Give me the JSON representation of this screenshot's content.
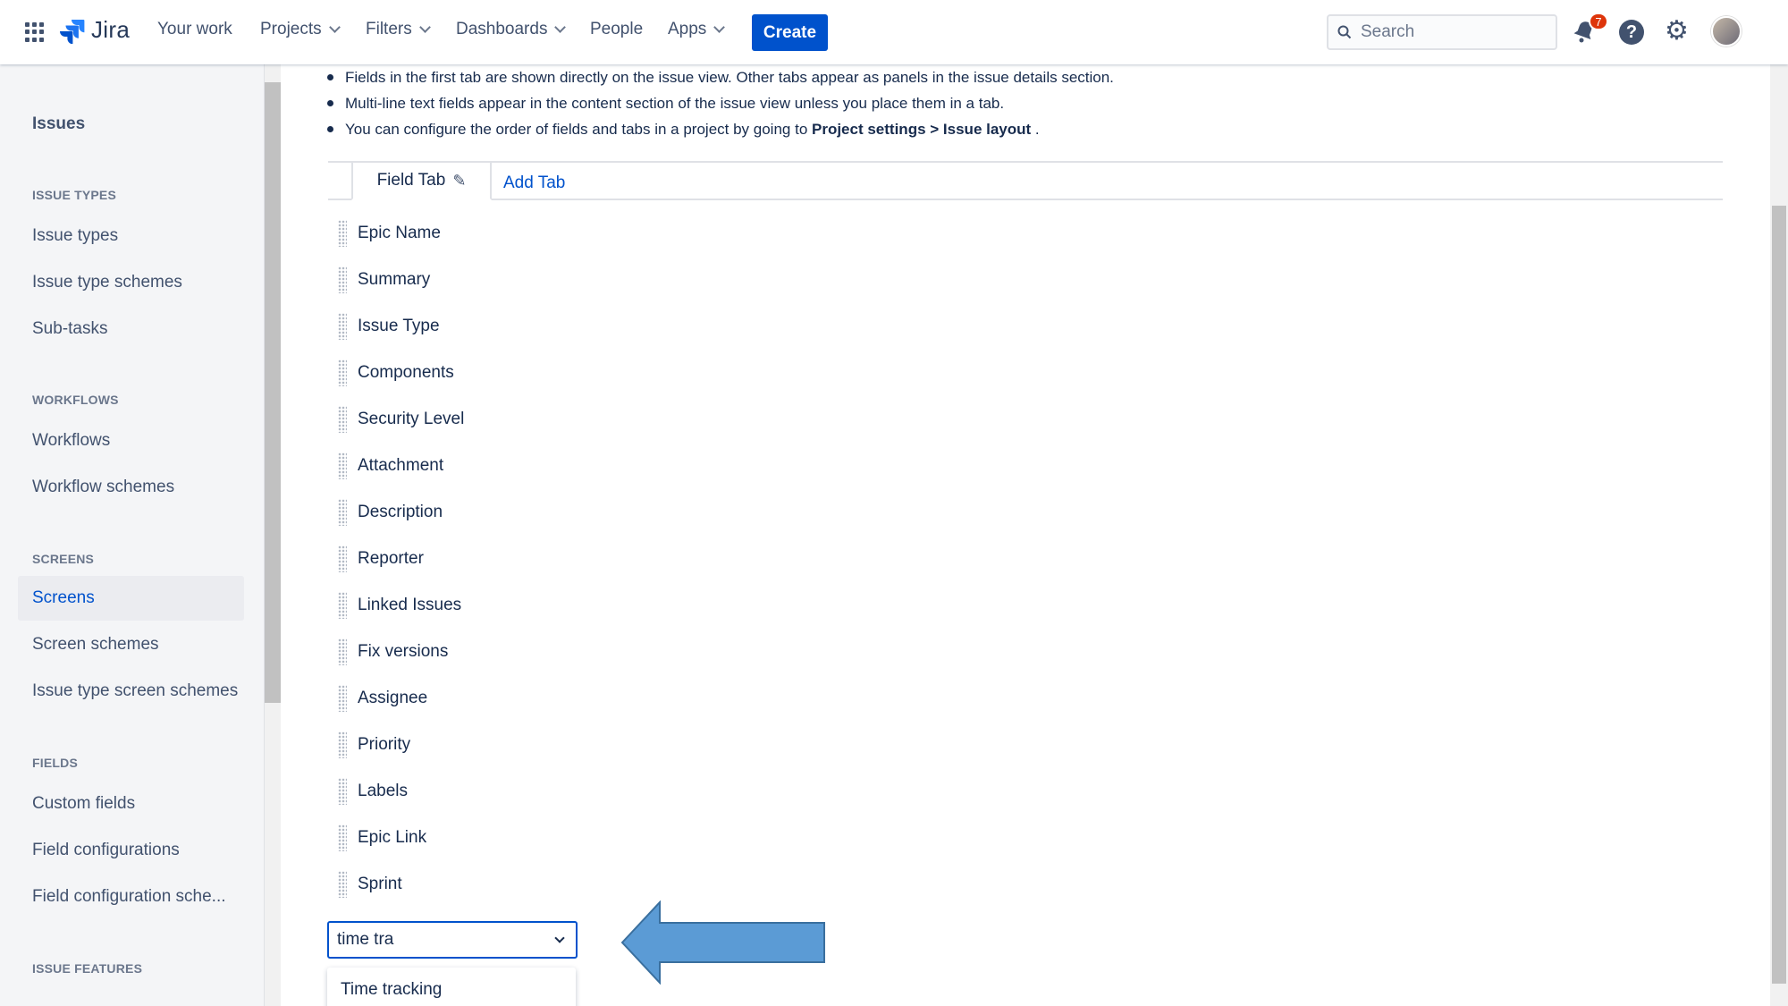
{
  "nav": {
    "logo": "Jira",
    "your_work": "Your work",
    "projects": "Projects",
    "filters": "Filters",
    "dashboards": "Dashboards",
    "people": "People",
    "apps": "Apps",
    "create": "Create",
    "search_placeholder": "Search",
    "notification_count": "7",
    "help": "?"
  },
  "sidebar": {
    "title": "Issues",
    "sections": {
      "issue_types": "ISSUE TYPES",
      "workflows": "WORKFLOWS",
      "screens": "SCREENS",
      "fields": "FIELDS",
      "issue_features": "ISSUE FEATURES"
    },
    "items": {
      "issue_types": "Issue types",
      "issue_type_schemes": "Issue type schemes",
      "sub_tasks": "Sub-tasks",
      "workflows": "Workflows",
      "workflow_schemes": "Workflow schemes",
      "screens": "Screens",
      "screen_schemes": "Screen schemes",
      "issue_type_screen_schemes": "Issue type screen schemes",
      "custom_fields": "Custom fields",
      "field_configurations": "Field configurations",
      "field_configuration_schemes": "Field configuration sche..."
    }
  },
  "main": {
    "bullets": {
      "b1": "Fields in the first tab are shown directly on the issue view. Other tabs appear as panels in the issue details section.",
      "b2": "Multi-line text fields appear in the content section of the issue view unless you place them in a tab.",
      "b3_prefix": "You can configure the order of fields and tabs in a project by going to ",
      "b3_bold1": "Project settings",
      "b3_sep": " > ",
      "b3_bold2": "Issue layout",
      "b3_suffix": " ."
    },
    "tabs": {
      "field_tab": "Field Tab",
      "add_tab": "Add Tab"
    },
    "fields": [
      "Epic Name",
      "Summary",
      "Issue Type",
      "Components",
      "Security Level",
      "Attachment",
      "Description",
      "Reporter",
      "Linked Issues",
      "Fix versions",
      "Assignee",
      "Priority",
      "Labels",
      "Epic Link",
      "Sprint"
    ],
    "select_value": "time tra",
    "dropdown_option": "Time tracking"
  },
  "colors": {
    "brand": "#0052cc",
    "arrow": "#5b9bd5"
  }
}
